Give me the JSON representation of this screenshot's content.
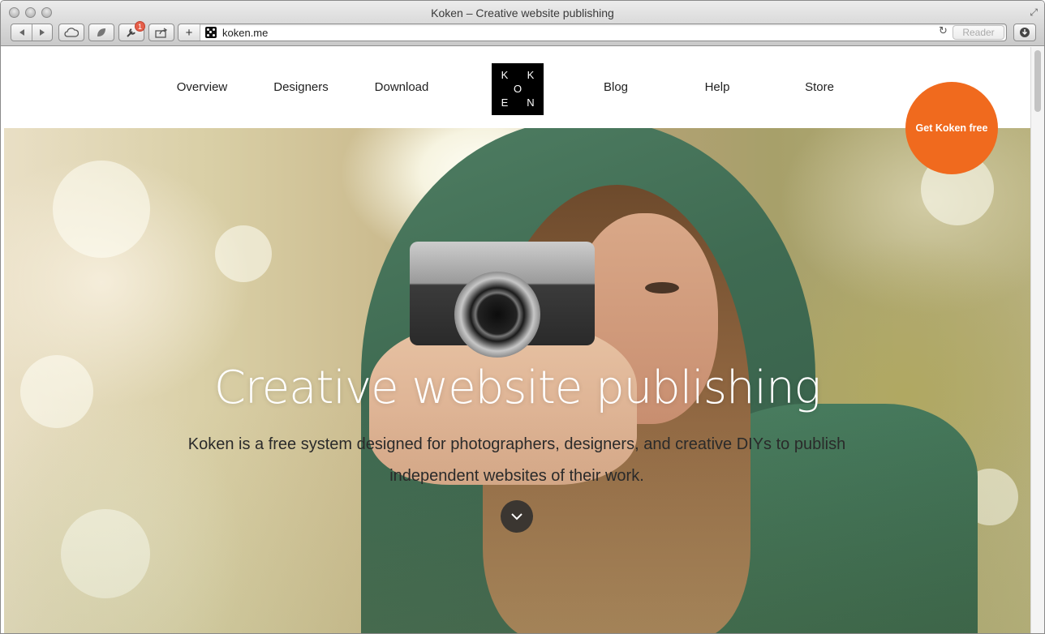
{
  "window": {
    "title": "Koken – Creative website publishing"
  },
  "toolbar": {
    "back_icon": "back-arrow-icon",
    "forward_icon": "forward-arrow-icon",
    "icloud_icon": "cloud-icon",
    "bookmarks_icon": "leaf-icon",
    "extensions_badge": "1",
    "share_icon": "share-icon",
    "address": "koken.me",
    "reader_label": "Reader",
    "download_icon": "download-icon"
  },
  "site": {
    "nav_left": [
      "Overview",
      "Designers",
      "Download"
    ],
    "nav_right": [
      "Blog",
      "Help",
      "Store"
    ],
    "logo_letters": [
      "K",
      "K",
      "O",
      "E",
      "N"
    ],
    "cta_label": "Get Koken free",
    "cta_color": "#f06a1e"
  },
  "hero": {
    "title": "Creative website publishing",
    "subtitle_line1": "Koken is a free system designed for photographers, designers, and creative DIYs to publish",
    "subtitle_line2": "independent websites of their work.",
    "scroll_icon": "chevron-down-icon"
  }
}
